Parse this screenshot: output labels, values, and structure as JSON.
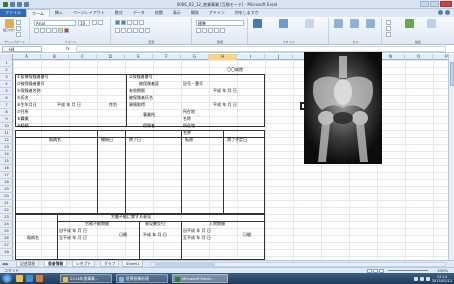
{
  "window": {
    "title": "0066_02_12_産業事業 [互換モード] - Microsoft Excel"
  },
  "ribbon": {
    "tabs": [
      "ファイル",
      "ホーム",
      "挿入",
      "ページレイアウト",
      "数式",
      "データ",
      "校閲",
      "表示",
      "開発",
      "アドイン",
      "何をしますか"
    ],
    "active_tab": "ホーム",
    "font_name": "Arial",
    "font_size": "10",
    "number_format": "標準",
    "groups": [
      "クリップボード",
      "フォント",
      "配置",
      "数値",
      "スタイル",
      "セル",
      "編集"
    ],
    "buttons": {
      "paste": "貼り付け",
      "conditional": "条件付き書式",
      "table": "テーブルとして書式設定",
      "cellstyle": "セルのスタイル",
      "insert": "挿入",
      "delete": "削除",
      "format": "書式",
      "sort": "並べ替えとフィルター",
      "find": "検索と選択"
    }
  },
  "formula_bar": {
    "name_box": "H4",
    "fx": "fx",
    "value": ""
  },
  "grid": {
    "columns": [
      "A",
      "B",
      "C",
      "D",
      "E",
      "F",
      "G",
      "H",
      "I",
      "J",
      "K",
      "L",
      "M",
      "N",
      "O",
      "P"
    ],
    "selected_column": "H",
    "rows": [
      "1",
      "2",
      "3",
      "4",
      "5",
      "6",
      "7",
      "8",
      "9",
      "10",
      "11",
      "12",
      "13",
      "14",
      "15",
      "16",
      "17",
      "18",
      "19",
      "20",
      "21",
      "22",
      "23",
      "24",
      "25",
      "26",
      "27",
      "28"
    ],
    "cells": {
      "r2_f": "〇〇病院",
      "r3_a": "①医療保険者番号",
      "r3_e": "②保険者番号",
      "r4_a": "③被保険者番号",
      "r4_e": "被保険者証",
      "r4_f": "記号・番号",
      "r5_a": "④保険者名称",
      "r5_e": "有効期限",
      "r5_f": "平成 年 月 日",
      "r6_a": "⑤氏名",
      "r6_e": "被保険者氏名",
      "r7_a": "⑥生年月日",
      "r7_b": "平成 年 月 日",
      "r7_c": "性別",
      "r7_e": "資格取得",
      "r7_f": "平成 年 月 日",
      "r8_a": "⑦住所",
      "r8_e": "事業所",
      "r8_f": "所在地",
      "r9_a": "⑧職業",
      "r9_f": "名称",
      "r10_a": "⑨続柄",
      "r10_e": "保険者",
      "r10_f": "所在地",
      "r11_f": "名称",
      "r12_b": "傷病名",
      "r12_c": "開始日",
      "r12_d": "終了日",
      "r12_e": "転帰",
      "r12_f": "満了予定日",
      "r22_c": "労働不能に関する意見",
      "r23_b": "労務不能期間",
      "r23_d": "意見書交付",
      "r23_f": "入院期間",
      "r24_a": "傷病名",
      "r24_b1": "自平成 年 月 日",
      "r24_b2": "至平成 年 月 日",
      "r24_c": "日間",
      "r24_d": "平成 年 月 日",
      "r24_f1": "自平成 年 月 日",
      "r24_f2": "至平成 年 月 日",
      "r24_g": "日間"
    }
  },
  "sheets": {
    "tabs": [
      "記述用紙",
      "患者情報",
      "レセプト",
      "グラフ",
      "Sheet1"
    ],
    "active": "患者情報"
  },
  "status": {
    "mode": "コマンド",
    "zoom": "100%"
  },
  "taskbar": {
    "tasks": [
      "2014年度事業...",
      "医療画像処理",
      "Microsoft Excel..."
    ],
    "clock": "12:14",
    "date": "2015/02/12"
  },
  "colors": {
    "accent": "#2a6db8",
    "selection": "#f7d67c",
    "ribbon": "#dfe9f5"
  },
  "image": {
    "name": "pelvis-xray"
  }
}
